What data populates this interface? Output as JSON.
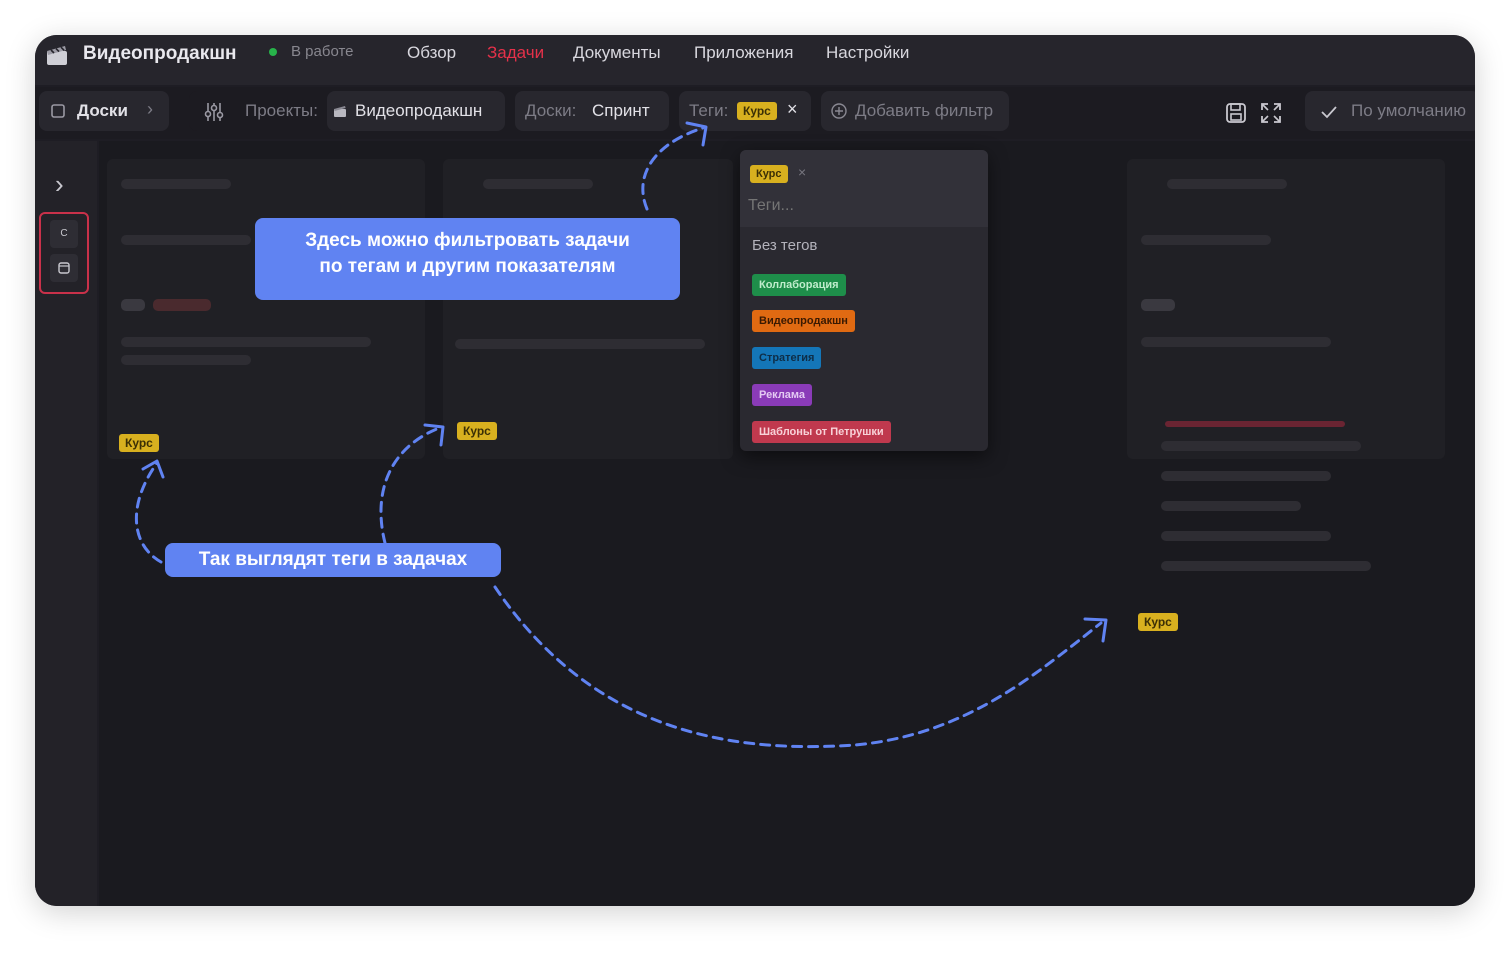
{
  "app": {
    "title": "Видеопродакшн",
    "status": "В работе"
  },
  "nav": {
    "overview": "Обзор",
    "tasks": "Задачи",
    "documents": "Документы",
    "apps": "Приложения",
    "settings": "Настройки",
    "active_color": "#e5314a"
  },
  "toolbar": {
    "boards_label": "Доски",
    "projects_label": "Проекты:",
    "projects_value": "Видеопродакшн",
    "boards_filter_label": "Доски:",
    "boards_filter_value": "Спринт",
    "tags_label": "Теги:",
    "tags_value": "Курс",
    "add_filter": "Добавить фильтр",
    "default_view": "По умолчанию"
  },
  "sidebar": {
    "letter": "C"
  },
  "dropdown": {
    "selected_tag": "Курс",
    "search_placeholder": "Теги...",
    "no_tags": "Без тегов",
    "tags": [
      {
        "label": "Коллаборация",
        "color": "#1e8e4a"
      },
      {
        "label": "Видеопродакшн",
        "color": "#e06a12"
      },
      {
        "label": "Стратегия",
        "color": "#1476b8"
      },
      {
        "label": "Реклама",
        "color": "#8a3bb8"
      },
      {
        "label": "Шаблоны от Петрушки",
        "color": "#c0394e"
      }
    ]
  },
  "task_tags": {
    "card1": "Курс",
    "card2": "Курс",
    "card3": "Курс"
  },
  "callouts": {
    "filter_line1": "Здесь можно фильтровать задачи",
    "filter_line2": "по тегам и другим показателям",
    "tags_in_tasks": "Так выглядят теги в задачах"
  },
  "colors": {
    "accent_callout": "#6083f2",
    "tag_kurs": "#d8b01f",
    "status_green": "#27b34a"
  }
}
